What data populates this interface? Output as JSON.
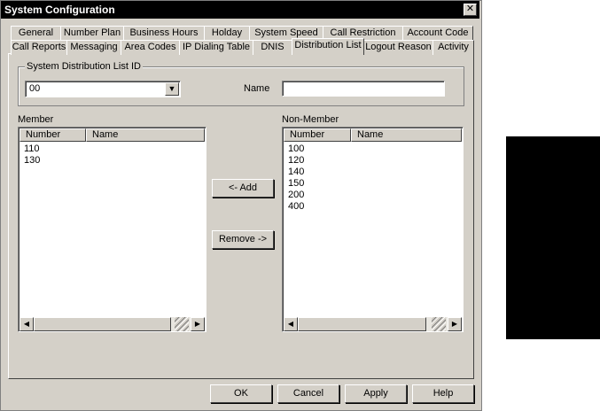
{
  "window": {
    "title": "System Configuration",
    "close_glyph": "✕"
  },
  "tabs_row1": [
    "General",
    "Number Plan",
    "Business Hours",
    "Holday",
    "System Speed",
    "Call Restriction",
    "Account Code"
  ],
  "tabs_row2": [
    "Call Reports",
    "Messaging",
    "Area Codes",
    "IP Dialing Table",
    "DNIS",
    "Distribution List",
    "Logout Reason",
    "Activity"
  ],
  "active_tab": "Distribution List",
  "group": {
    "label": "System Distribution List ID",
    "id_value": "00",
    "name_label": "Name",
    "name_value": ""
  },
  "member": {
    "label": "Member",
    "columns": [
      "Number",
      "Name"
    ],
    "rows": [
      "110",
      "130"
    ]
  },
  "nonmember": {
    "label": "Non-Member",
    "columns": [
      "Number",
      "Name"
    ],
    "rows": [
      "100",
      "120",
      "140",
      "150",
      "200",
      "400"
    ]
  },
  "buttons": {
    "add": "<- Add",
    "remove": "Remove ->",
    "ok": "OK",
    "cancel": "Cancel",
    "apply": "Apply",
    "help": "Help"
  },
  "icons": {
    "dropdown": "▼",
    "scroll_left": "◀",
    "scroll_right": "▶"
  }
}
